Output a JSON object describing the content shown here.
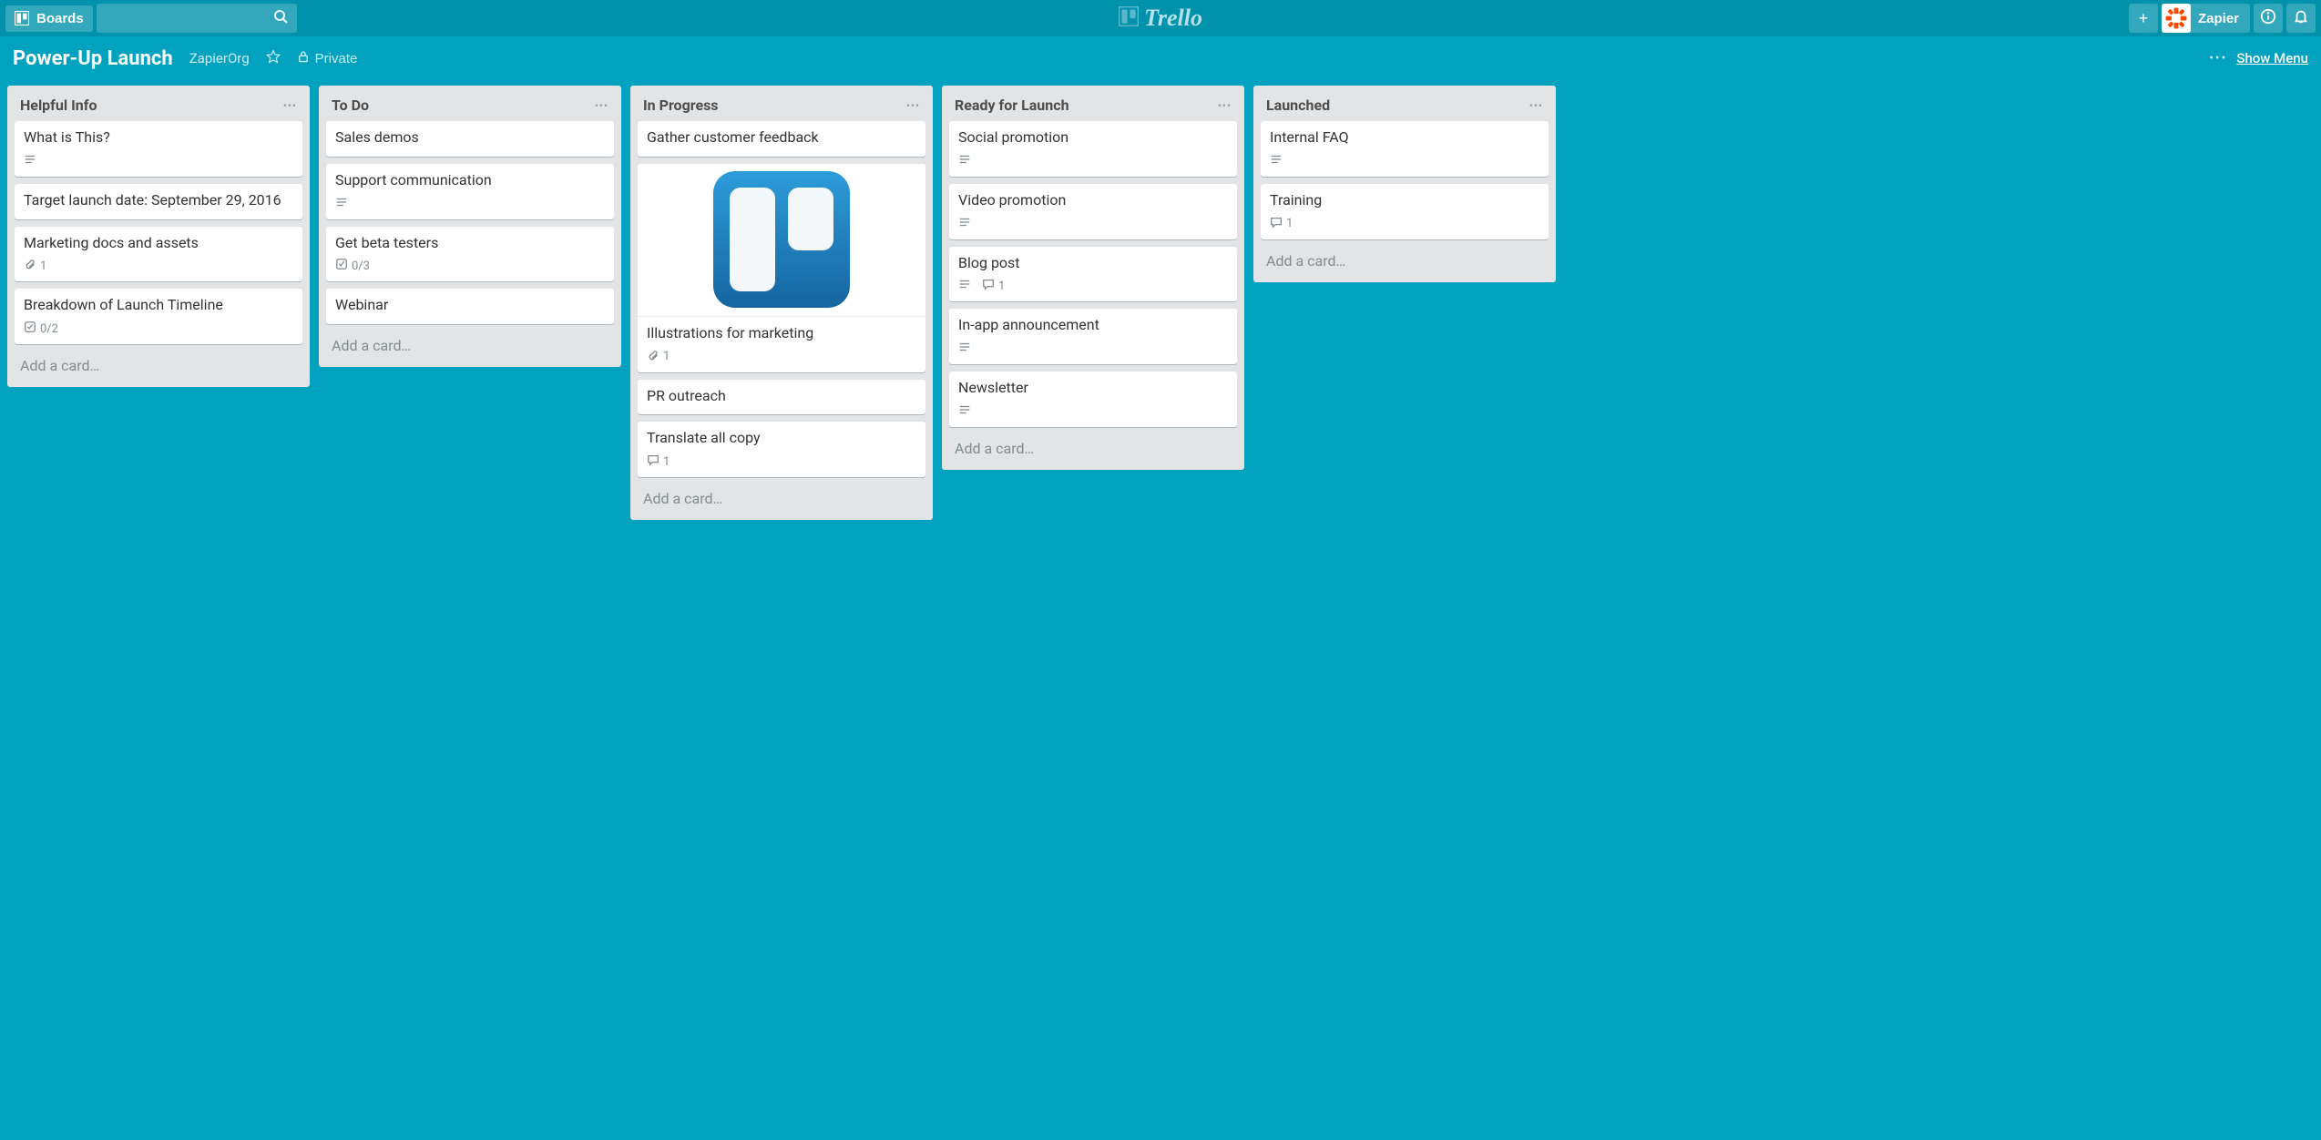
{
  "header": {
    "boards_label": "Boards",
    "logo_text": "Trello",
    "user_name": "Zapier"
  },
  "board": {
    "name": "Power-Up Launch",
    "org": "ZapierOrg",
    "visibility": "Private",
    "show_menu": "Show Menu"
  },
  "add_card_label": "Add a card…",
  "lists": [
    {
      "title": "Helpful Info",
      "cards": [
        {
          "title": "What is This?",
          "badges": {
            "description": true
          }
        },
        {
          "title": "Target launch date: September 29, 2016",
          "badges": {}
        },
        {
          "title": "Marketing docs and assets",
          "badges": {
            "attachments": "1"
          }
        },
        {
          "title": "Breakdown of Launch Timeline",
          "badges": {
            "checklist": "0/2"
          }
        }
      ]
    },
    {
      "title": "To Do",
      "cards": [
        {
          "title": "Sales demos",
          "badges": {}
        },
        {
          "title": "Support communication",
          "badges": {
            "description": true
          }
        },
        {
          "title": "Get beta testers",
          "badges": {
            "checklist": "0/3"
          }
        },
        {
          "title": "Webinar",
          "badges": {}
        }
      ]
    },
    {
      "title": "In Progress",
      "cards": [
        {
          "title": "Gather customer feedback",
          "badges": {}
        },
        {
          "title": "Illustrations for marketing",
          "badges": {
            "attachments": "1"
          },
          "cover": true
        },
        {
          "title": "PR outreach",
          "badges": {}
        },
        {
          "title": "Translate all copy",
          "badges": {
            "comments": "1"
          }
        }
      ]
    },
    {
      "title": "Ready for Launch",
      "cards": [
        {
          "title": "Social promotion",
          "badges": {
            "description": true
          }
        },
        {
          "title": "Video promotion",
          "badges": {
            "description": true
          }
        },
        {
          "title": "Blog post",
          "badges": {
            "description": true,
            "comments": "1"
          }
        },
        {
          "title": "In-app announcement",
          "badges": {
            "description": true
          }
        },
        {
          "title": "Newsletter",
          "badges": {
            "description": true
          }
        }
      ]
    },
    {
      "title": "Launched",
      "cards": [
        {
          "title": "Internal FAQ",
          "badges": {
            "description": true
          }
        },
        {
          "title": "Training",
          "badges": {
            "comments": "1"
          }
        }
      ]
    }
  ]
}
